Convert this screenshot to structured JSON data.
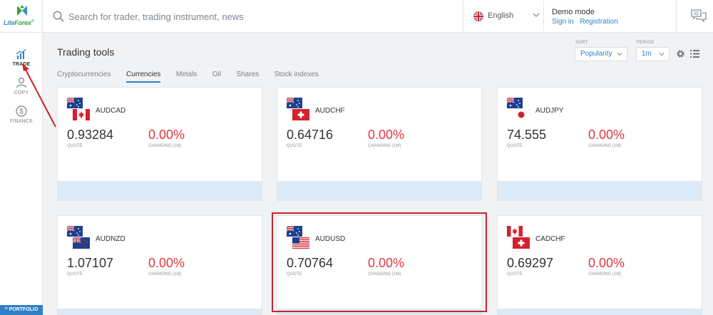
{
  "brand": {
    "logo_text_a": "Lite",
    "logo_text_b": "Forex",
    "logo_mark": "®"
  },
  "header": {
    "search_placeholder": "Search for trader, trading instrument, news",
    "language": "English",
    "account_mode": "Demo mode",
    "sign_in": "Sign in",
    "registration": "Registration"
  },
  "sidebar": {
    "items": [
      {
        "label": "TRADE",
        "icon": "chart-icon",
        "active": true
      },
      {
        "label": "COPY",
        "icon": "users-icon",
        "active": false
      },
      {
        "label": "FINANCE",
        "icon": "dollar-icon",
        "active": false
      }
    ],
    "portfolio": "^ PORTFOLIO"
  },
  "main": {
    "title": "Trading tools",
    "tabs": [
      "Cryptocurrencies",
      "Currencies",
      "Metals",
      "Oil",
      "Shares",
      "Stock indexes"
    ],
    "active_tab": "Currencies",
    "sort_label": "SORT",
    "sort_value": "Popularity",
    "period_label": "PERIOD",
    "period_value": "1m",
    "quote_label": "QUOTE",
    "changing_label": "CHANGING (1M)",
    "cards": [
      {
        "symbol": "AUDCAD",
        "quote": "0.93284",
        "change": "0.00%",
        "flags": [
          "AU",
          "CA"
        ]
      },
      {
        "symbol": "AUDCHF",
        "quote": "0.64716",
        "change": "0.00%",
        "flags": [
          "AU",
          "CH"
        ]
      },
      {
        "symbol": "AUDJPY",
        "quote": "74.555",
        "change": "0.00%",
        "flags": [
          "AU",
          "JP"
        ]
      },
      {
        "symbol": "AUDNZD",
        "quote": "1.07107",
        "change": "0.00%",
        "flags": [
          "AU",
          "NZ"
        ]
      },
      {
        "symbol": "AUDUSD",
        "quote": "0.70764",
        "change": "0.00%",
        "flags": [
          "AU",
          "US"
        ],
        "highlighted": true
      },
      {
        "symbol": "CADCHF",
        "quote": "0.69297",
        "change": "0.00%",
        "flags": [
          "CA",
          "CH"
        ]
      }
    ]
  },
  "colors": {
    "accent": "#2f80c7",
    "negative": "#e2383f",
    "card_footer": "#dbeaf6",
    "annotation": "#c8242b"
  }
}
